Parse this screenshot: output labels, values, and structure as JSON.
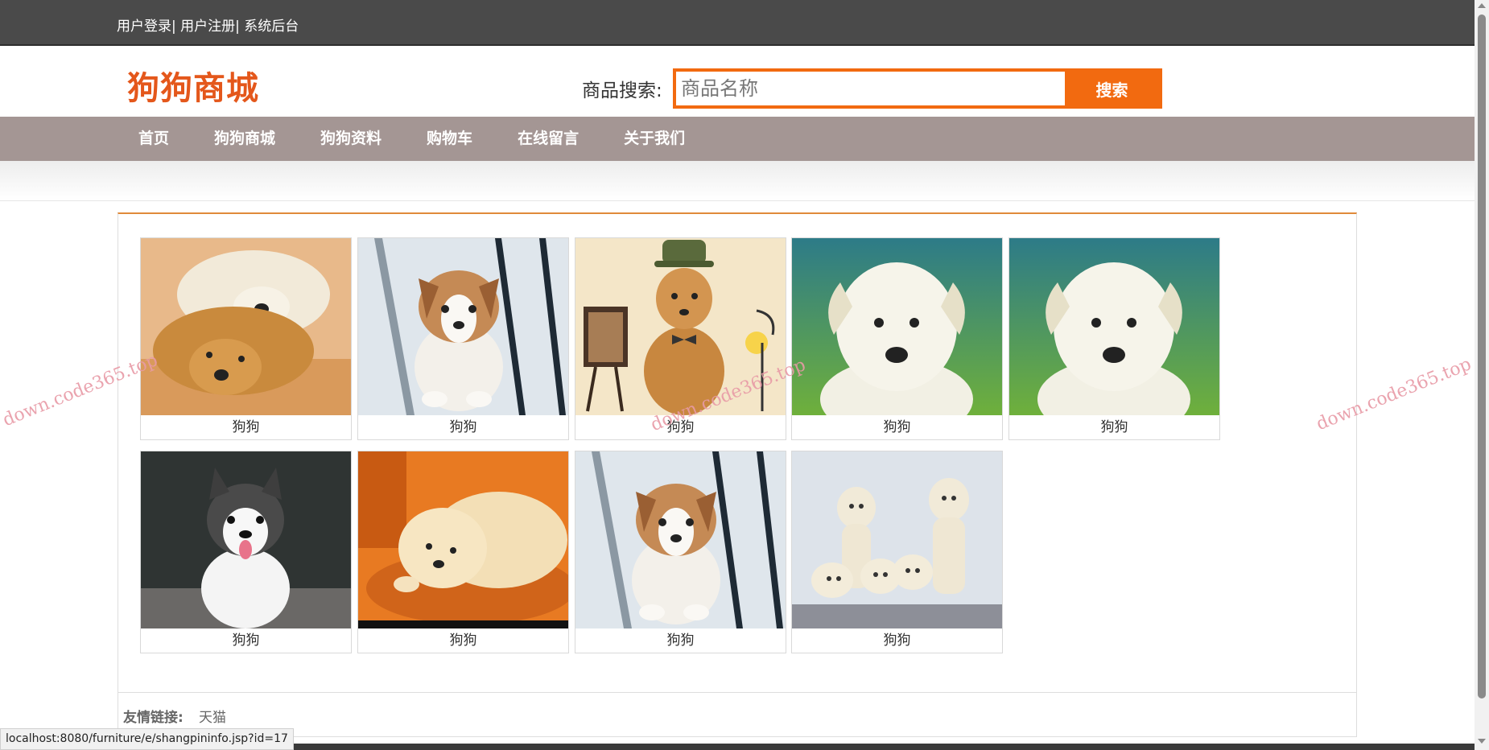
{
  "topbar": {
    "login": "用户登录",
    "register": "用户注册",
    "admin": "系统后台"
  },
  "header": {
    "logo": "狗狗商城",
    "search_label": "商品搜索:",
    "search_placeholder": "商品名称",
    "search_button": "搜索"
  },
  "nav": [
    "首页",
    "狗狗商城",
    "狗狗资料",
    "购物车",
    "在线留言",
    "关于我们"
  ],
  "products": [
    {
      "name": "狗狗",
      "pic": "golden-pair-icon"
    },
    {
      "name": "狗狗",
      "pic": "corgi-puppy-icon"
    },
    {
      "name": "狗狗",
      "pic": "golden-hat-puppy-icon"
    },
    {
      "name": "狗狗",
      "pic": "white-puppy-icon"
    },
    {
      "name": "狗狗",
      "pic": "white-puppy-icon"
    },
    {
      "name": "狗狗",
      "pic": "husky-puppy-icon"
    },
    {
      "name": "狗狗",
      "pic": "cream-puppy-icon"
    },
    {
      "name": "狗狗",
      "pic": "corgi-puppy-icon"
    },
    {
      "name": "狗狗",
      "pic": "labrador-puppies-icon"
    }
  ],
  "footer": {
    "links_label": "友情链接:",
    "links": [
      "天猫"
    ]
  },
  "status_bar": "localhost:8080/furniture/e/shangpininfo.jsp?id=17",
  "watermark": "down.code365.top",
  "colors": {
    "topbar": "#4a4a4a",
    "brand": "#e4571b",
    "accent": "#f26a10",
    "nav": "#a49694"
  }
}
